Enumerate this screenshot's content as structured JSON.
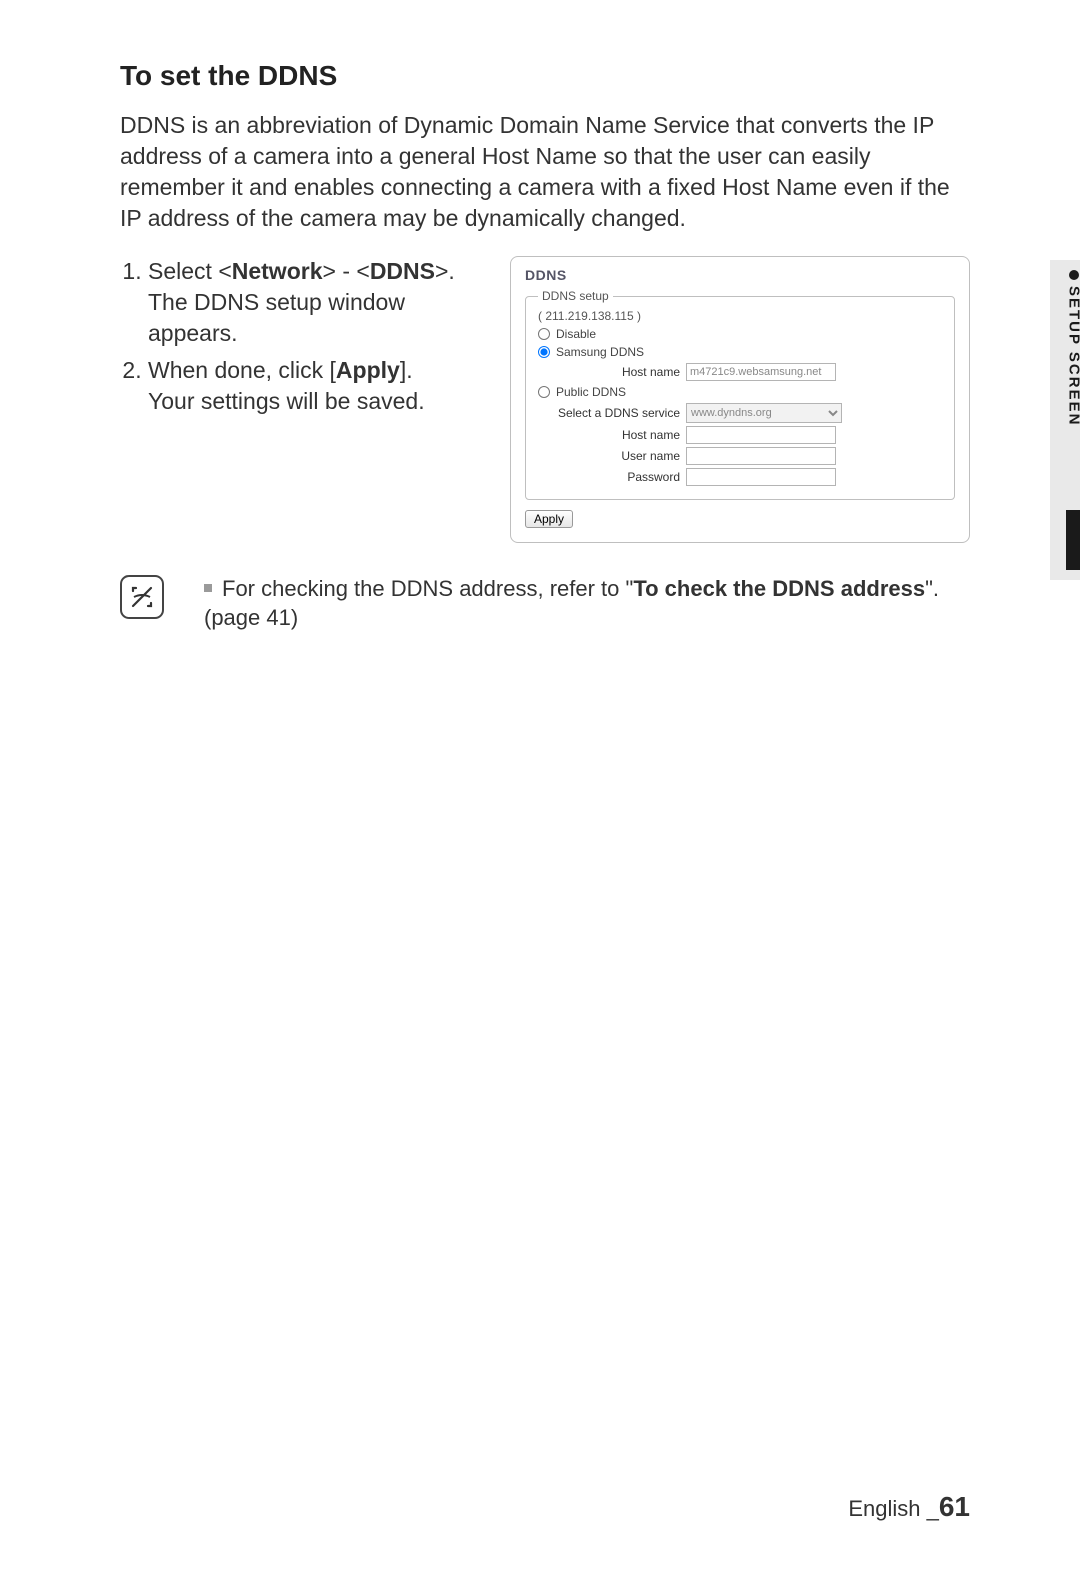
{
  "title": "To set the DDNS",
  "intro": "DDNS is an abbreviation of Dynamic Domain Name Service that converts the IP address of a camera into a general Host Name so that the user can easily remember it and enables connecting a camera with a fixed Host Name even if the IP address of the camera may be dynamically changed.",
  "steps": {
    "s1a": "Select <",
    "s1b": "Network",
    "s1c": "> - <",
    "s1d": "DDNS",
    "s1e": ">.",
    "s1f": "The DDNS setup window appears.",
    "s2a": "When done, click [",
    "s2b": "Apply",
    "s2c": "].",
    "s2d": "Your settings will be saved."
  },
  "panel": {
    "title": "DDNS",
    "legend": "DDNS setup",
    "ip": "( 211.219.138.115 )",
    "opt_disable": "Disable",
    "opt_samsung": "Samsung DDNS",
    "samsung_host_label": "Host name",
    "samsung_host_value": "m4721c9.websamsung.net",
    "opt_public": "Public DDNS",
    "service_label": "Select a DDNS service",
    "service_value": "www.dyndns.org",
    "host_label": "Host name",
    "user_label": "User name",
    "pass_label": "Password",
    "apply": "Apply"
  },
  "note": {
    "pre": "For checking the DDNS address, refer to \"",
    "bold": "To check the DDNS address",
    "post": "\". (page 41)"
  },
  "sidetab": "SETUP SCREEN",
  "footer": {
    "lang": "English _",
    "page": "61"
  }
}
